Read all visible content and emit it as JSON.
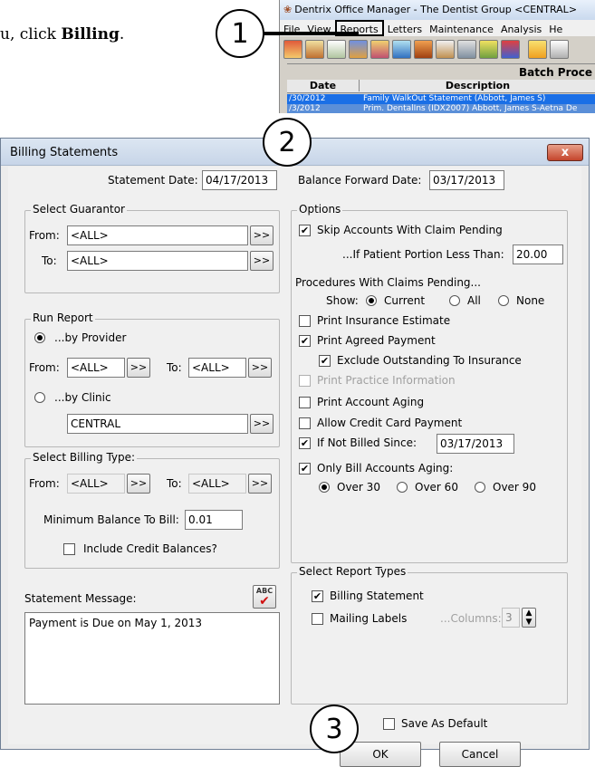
{
  "instruction": {
    "prefix": "u, click ",
    "bold": "Billing",
    "suffix": "."
  },
  "callouts": [
    "1",
    "2",
    "3"
  ],
  "bg_window": {
    "title": "Dentrix Office Manager - The Dentist Group <CENTRAL>",
    "menu": [
      "File",
      "View",
      "Reports",
      "Letters",
      "Maintenance",
      "Analysis",
      "He"
    ],
    "selected_menu": "Reports",
    "batch_title": "Batch Proce",
    "columns": [
      "Date",
      "Description"
    ],
    "rows": [
      {
        "date": "/30/2012",
        "desc": "Family WalkOut Statement (Abbott, James S)"
      },
      {
        "date": "/3/2012",
        "desc": "Prim. DentalIns (IDX2007) Abbott, James S-Aetna De"
      }
    ]
  },
  "dialog": {
    "title": "Billing Statements",
    "statement_date_label": "Statement Date:",
    "statement_date": "04/17/2013",
    "balance_forward_label": "Balance Forward Date:",
    "balance_forward": "03/17/2013",
    "select_guarantor": {
      "title": "Select Guarantor",
      "from_label": "From:",
      "from_value": "<ALL>",
      "to_label": "To:",
      "to_value": "<ALL>",
      "browse": ">>"
    },
    "run_report": {
      "title": "Run Report",
      "by_provider": "...by Provider",
      "from_label": "From:",
      "from_value": "<ALL>",
      "to_label": "To:",
      "to_value": "<ALL>",
      "by_clinic": "...by Clinic",
      "clinic_value": "CENTRAL",
      "browse": ">>"
    },
    "billing_type": {
      "title": "Select Billing Type:",
      "from_label": "From:",
      "from_value": "<ALL>",
      "to_label": "To:",
      "to_value": "<ALL>",
      "browse": ">>",
      "min_balance_label": "Minimum Balance To Bill:",
      "min_balance": "0.01",
      "include_credit": "Include Credit Balances?"
    },
    "statement_message": {
      "label": "Statement Message:",
      "spell_icon": "ABC",
      "text": "Payment is Due on May 1, 2013"
    },
    "options": {
      "title": "Options",
      "skip_claim": "Skip Accounts With Claim Pending",
      "portion_label": "...If Patient Portion Less Than:",
      "portion_value": "20.00",
      "procedures_label": "Procedures With Claims Pending...",
      "show_label": "Show:",
      "show_current": "Current",
      "show_all": "All",
      "show_none": "None",
      "print_ins_estimate": "Print Insurance Estimate",
      "print_agreed": "Print Agreed Payment",
      "exclude_outstanding": "Exclude Outstanding To Insurance",
      "print_practice": "Print Practice Information",
      "print_aging": "Print Account Aging",
      "allow_cc": "Allow Credit Card Payment",
      "not_billed_label": "If Not Billed Since:",
      "not_billed_value": "03/17/2013",
      "only_bill_aging": "Only Bill Accounts Aging:",
      "over30": "Over 30",
      "over60": "Over 60",
      "over90": "Over 90"
    },
    "report_types": {
      "title": "Select Report Types",
      "billing_statement": "Billing Statement",
      "mailing_labels": "Mailing Labels",
      "columns_label": "...Columns:",
      "columns_value": "3"
    },
    "save_default": "Save As Default",
    "ok": "OK",
    "cancel": "Cancel",
    "close_icon": "x",
    "check_mark": "✔"
  },
  "colors": {
    "selection_blue": "#1a6fe6",
    "close_red": "#c4452c"
  }
}
